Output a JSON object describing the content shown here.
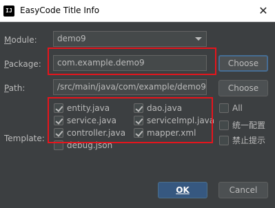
{
  "window": {
    "app_icon_text": "IJ",
    "title": "EasyCode Title Info",
    "close_glyph": "✕"
  },
  "module": {
    "label_prefix": "",
    "label_mnemonic": "M",
    "label_rest": "odule:",
    "value": "demo9"
  },
  "package": {
    "label_mnemonic": "P",
    "label_rest": "ackage:",
    "value": "com.example.demo9",
    "choose_label": "Choose"
  },
  "path": {
    "label_mnemonic": "P",
    "label_rest": "ath:",
    "value": "/src/main/java/com/example/demo9",
    "choose_label": "Choose"
  },
  "template": {
    "label": "Template:",
    "items": [
      {
        "label": "entity.java",
        "checked": true
      },
      {
        "label": "dao.java",
        "checked": true
      },
      {
        "label": "service.java",
        "checked": true
      },
      {
        "label": "serviceImpl.java",
        "checked": true
      },
      {
        "label": "controller.java",
        "checked": true
      },
      {
        "label": "mapper.xml",
        "checked": true
      },
      {
        "label": "debug.json",
        "checked": false
      }
    ],
    "options": [
      {
        "label": "All",
        "checked": false
      },
      {
        "label": "统一配置",
        "checked": false
      },
      {
        "label": "禁止提示",
        "checked": false
      }
    ]
  },
  "footer": {
    "ok_label": "OK",
    "cancel_label": "Cancel"
  },
  "colors": {
    "highlight_border": "#e8141c",
    "dialog_bg": "#3c3f41",
    "ok_button": "#365880"
  }
}
